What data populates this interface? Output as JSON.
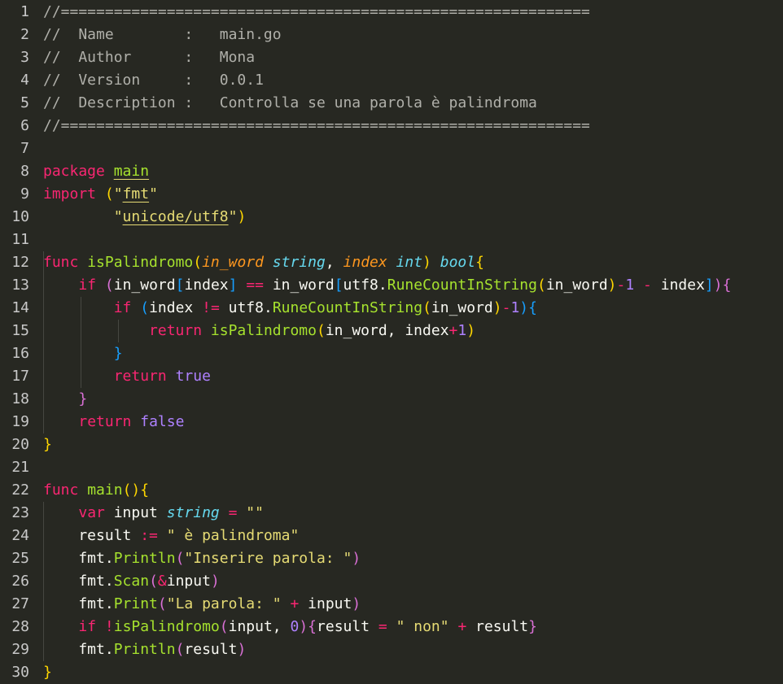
{
  "editor": {
    "language": "go",
    "colors": {
      "background": "#272822",
      "comment": "#b0b0aa",
      "keyword": "#f92672",
      "string": "#e6db74",
      "function": "#a6e22e",
      "type": "#66d9ef",
      "parameter": "#fd971f",
      "number": "#ae81ff",
      "bracket_level_1": "#ffd700",
      "bracket_level_2": "#da70d6",
      "bracket_level_3": "#179fff"
    },
    "lines": [
      {
        "n": "1",
        "tokens": [
          [
            "comment",
            "//============================================================"
          ]
        ]
      },
      {
        "n": "2",
        "tokens": [
          [
            "comment",
            "//  Name        :   main.go"
          ]
        ]
      },
      {
        "n": "3",
        "tokens": [
          [
            "comment",
            "//  Author      :   Mona"
          ]
        ]
      },
      {
        "n": "4",
        "tokens": [
          [
            "comment",
            "//  Version     :   0.0.1"
          ]
        ]
      },
      {
        "n": "5",
        "tokens": [
          [
            "comment",
            "//  Description :   Controlla se una parola è palindroma"
          ]
        ]
      },
      {
        "n": "6",
        "tokens": [
          [
            "comment",
            "//============================================================"
          ]
        ]
      },
      {
        "n": "7",
        "tokens": []
      },
      {
        "n": "8",
        "tokens": [
          [
            "kw",
            "package"
          ],
          [
            "plain",
            " "
          ],
          [
            "pkg-u",
            "main"
          ]
        ]
      },
      {
        "n": "9",
        "tokens": [
          [
            "kw",
            "import"
          ],
          [
            "plain",
            " "
          ],
          [
            "b1",
            "("
          ],
          [
            "str",
            "\""
          ],
          [
            "str-u",
            "fmt"
          ],
          [
            "str",
            "\""
          ]
        ]
      },
      {
        "n": "10",
        "tokens": [
          [
            "plain",
            "        "
          ],
          [
            "str",
            "\""
          ],
          [
            "str-u",
            "unicode/utf8"
          ],
          [
            "str",
            "\""
          ],
          [
            "b1",
            ")"
          ]
        ]
      },
      {
        "n": "11",
        "tokens": []
      },
      {
        "n": "12",
        "tokens": [
          [
            "kw",
            "func"
          ],
          [
            "plain",
            " "
          ],
          [
            "func",
            "isPalindromo"
          ],
          [
            "b1",
            "("
          ],
          [
            "param",
            "in_word"
          ],
          [
            "plain",
            " "
          ],
          [
            "type",
            "string"
          ],
          [
            "plain",
            ", "
          ],
          [
            "param",
            "index"
          ],
          [
            "plain",
            " "
          ],
          [
            "type",
            "int"
          ],
          [
            "b1",
            ")"
          ],
          [
            "plain",
            " "
          ],
          [
            "type",
            "bool"
          ],
          [
            "b1",
            "{"
          ]
        ]
      },
      {
        "n": "13",
        "tokens": [
          [
            "plain",
            "    "
          ],
          [
            "kw",
            "if"
          ],
          [
            "plain",
            " "
          ],
          [
            "b2",
            "("
          ],
          [
            "plain",
            "in_word"
          ],
          [
            "b3",
            "["
          ],
          [
            "plain",
            "index"
          ],
          [
            "b3",
            "]"
          ],
          [
            "plain",
            " "
          ],
          [
            "op",
            "=="
          ],
          [
            "plain",
            " in_word"
          ],
          [
            "b3",
            "["
          ],
          [
            "plain",
            "utf8."
          ],
          [
            "func",
            "RuneCountInString"
          ],
          [
            "b1",
            "("
          ],
          [
            "plain",
            "in_word"
          ],
          [
            "b1",
            ")"
          ],
          [
            "op",
            "-"
          ],
          [
            "num",
            "1"
          ],
          [
            "plain",
            " "
          ],
          [
            "op",
            "-"
          ],
          [
            "plain",
            " index"
          ],
          [
            "b3",
            "]"
          ],
          [
            "b2",
            ")"
          ],
          [
            "b2",
            "{"
          ]
        ]
      },
      {
        "n": "14",
        "tokens": [
          [
            "plain",
            "        "
          ],
          [
            "kw",
            "if"
          ],
          [
            "plain",
            " "
          ],
          [
            "b3",
            "("
          ],
          [
            "plain",
            "index "
          ],
          [
            "op",
            "!="
          ],
          [
            "plain",
            " utf8."
          ],
          [
            "func",
            "RuneCountInString"
          ],
          [
            "b1",
            "("
          ],
          [
            "plain",
            "in_word"
          ],
          [
            "b1",
            ")"
          ],
          [
            "op",
            "-"
          ],
          [
            "num",
            "1"
          ],
          [
            "b3",
            ")"
          ],
          [
            "b3",
            "{"
          ]
        ]
      },
      {
        "n": "15",
        "tokens": [
          [
            "plain",
            "            "
          ],
          [
            "kw",
            "return"
          ],
          [
            "plain",
            " "
          ],
          [
            "func",
            "isPalindromo"
          ],
          [
            "b1",
            "("
          ],
          [
            "plain",
            "in_word, index"
          ],
          [
            "op",
            "+"
          ],
          [
            "num",
            "1"
          ],
          [
            "b1",
            ")"
          ]
        ]
      },
      {
        "n": "16",
        "tokens": [
          [
            "plain",
            "        "
          ],
          [
            "b3",
            "}"
          ]
        ]
      },
      {
        "n": "17",
        "tokens": [
          [
            "plain",
            "        "
          ],
          [
            "kw",
            "return"
          ],
          [
            "plain",
            " "
          ],
          [
            "const",
            "true"
          ]
        ]
      },
      {
        "n": "18",
        "tokens": [
          [
            "plain",
            "    "
          ],
          [
            "b2",
            "}"
          ]
        ]
      },
      {
        "n": "19",
        "tokens": [
          [
            "plain",
            "    "
          ],
          [
            "kw",
            "return"
          ],
          [
            "plain",
            " "
          ],
          [
            "const",
            "false"
          ]
        ]
      },
      {
        "n": "20",
        "tokens": [
          [
            "b1",
            "}"
          ]
        ]
      },
      {
        "n": "21",
        "tokens": []
      },
      {
        "n": "22",
        "tokens": [
          [
            "kw",
            "func"
          ],
          [
            "plain",
            " "
          ],
          [
            "func",
            "main"
          ],
          [
            "b1",
            "("
          ],
          [
            "b1",
            ")"
          ],
          [
            "b1",
            "{"
          ]
        ]
      },
      {
        "n": "23",
        "tokens": [
          [
            "plain",
            "    "
          ],
          [
            "kw",
            "var"
          ],
          [
            "plain",
            " input "
          ],
          [
            "type",
            "string"
          ],
          [
            "plain",
            " "
          ],
          [
            "op",
            "="
          ],
          [
            "plain",
            " "
          ],
          [
            "str",
            "\"\""
          ]
        ]
      },
      {
        "n": "24",
        "tokens": [
          [
            "plain",
            "    result "
          ],
          [
            "op",
            ":="
          ],
          [
            "plain",
            " "
          ],
          [
            "str",
            "\" è palindroma\""
          ]
        ]
      },
      {
        "n": "25",
        "tokens": [
          [
            "plain",
            "    fmt."
          ],
          [
            "func",
            "Println"
          ],
          [
            "b2",
            "("
          ],
          [
            "str",
            "\"Inserire parola: \""
          ],
          [
            "b2",
            ")"
          ]
        ]
      },
      {
        "n": "26",
        "tokens": [
          [
            "plain",
            "    fmt."
          ],
          [
            "func",
            "Scan"
          ],
          [
            "b2",
            "("
          ],
          [
            "op",
            "&"
          ],
          [
            "plain",
            "input"
          ],
          [
            "b2",
            ")"
          ]
        ]
      },
      {
        "n": "27",
        "tokens": [
          [
            "plain",
            "    fmt."
          ],
          [
            "func",
            "Print"
          ],
          [
            "b2",
            "("
          ],
          [
            "str",
            "\"La parola: \""
          ],
          [
            "plain",
            " "
          ],
          [
            "op",
            "+"
          ],
          [
            "plain",
            " input"
          ],
          [
            "b2",
            ")"
          ]
        ]
      },
      {
        "n": "28",
        "tokens": [
          [
            "plain",
            "    "
          ],
          [
            "kw",
            "if"
          ],
          [
            "plain",
            " "
          ],
          [
            "op",
            "!"
          ],
          [
            "func",
            "isPalindromo"
          ],
          [
            "b2",
            "("
          ],
          [
            "plain",
            "input, "
          ],
          [
            "num",
            "0"
          ],
          [
            "b2",
            ")"
          ],
          [
            "b2",
            "{"
          ],
          [
            "plain",
            "result "
          ],
          [
            "op",
            "="
          ],
          [
            "plain",
            " "
          ],
          [
            "str",
            "\" non\""
          ],
          [
            "plain",
            " "
          ],
          [
            "op",
            "+"
          ],
          [
            "plain",
            " result"
          ],
          [
            "b2",
            "}"
          ]
        ]
      },
      {
        "n": "29",
        "tokens": [
          [
            "plain",
            "    fmt."
          ],
          [
            "func",
            "Println"
          ],
          [
            "b2",
            "("
          ],
          [
            "plain",
            "result"
          ],
          [
            "b2",
            ")"
          ]
        ]
      },
      {
        "n": "30",
        "tokens": [
          [
            "b1",
            "}"
          ]
        ]
      }
    ]
  }
}
